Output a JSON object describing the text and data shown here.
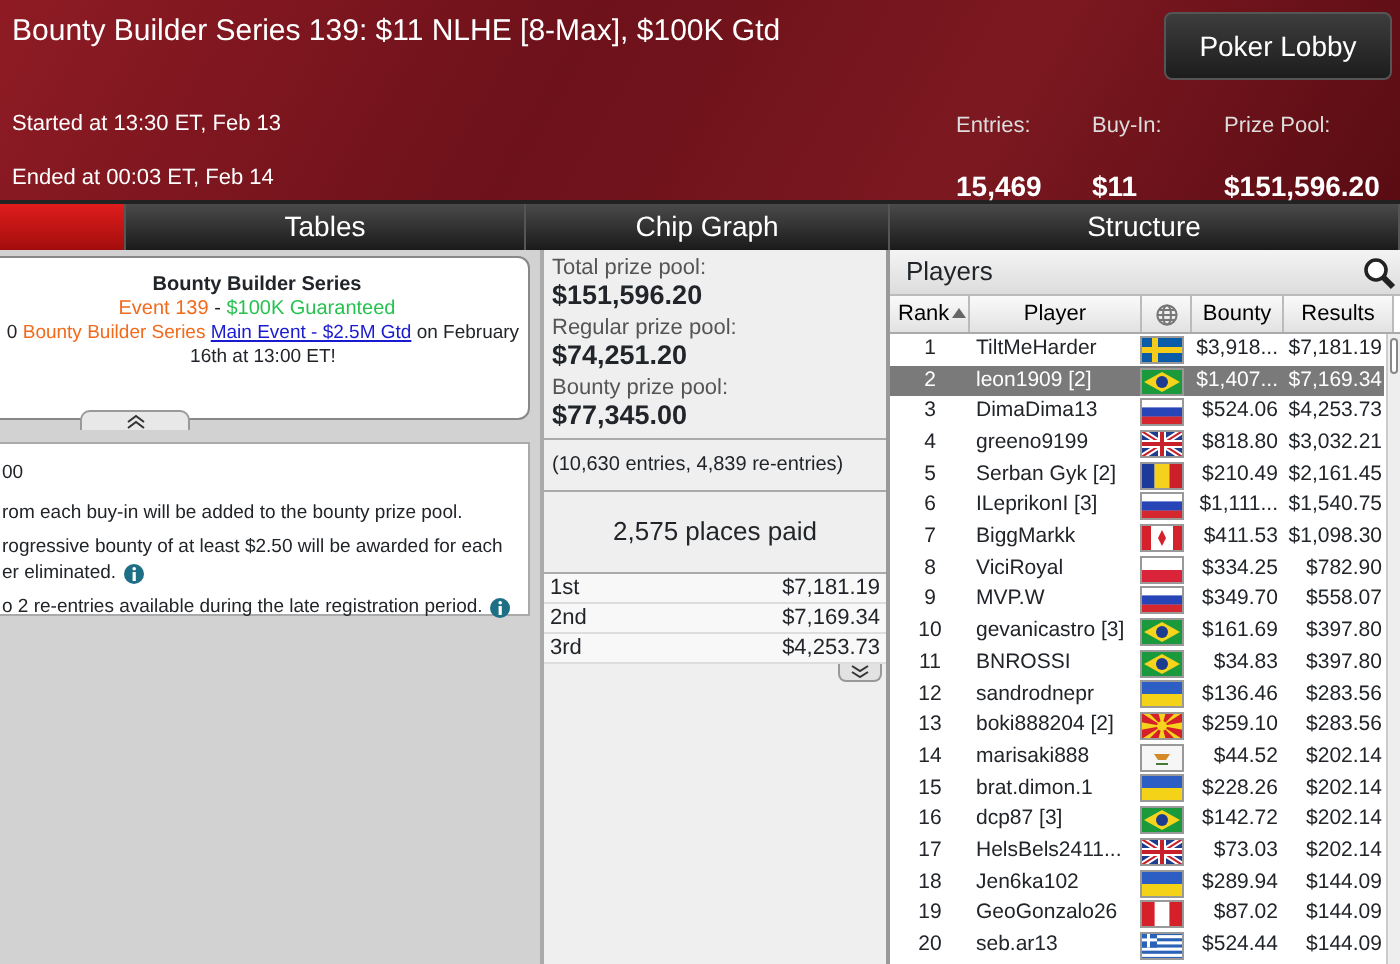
{
  "header": {
    "title": "Bounty Builder Series 139: $11 NLHE [8-Max], $100K Gtd",
    "lobby_button": "Poker Lobby",
    "started": "Started at 13:30 ET, Feb 13",
    "ended": "Ended at 00:03 ET, Feb 14",
    "stats": [
      {
        "label": "Entries:",
        "value": "15,469"
      },
      {
        "label": "Buy-In:",
        "value": "$11"
      },
      {
        "label": "Prize Pool:",
        "value": "$151,596.20"
      }
    ]
  },
  "tabs": [
    {
      "selected": true
    },
    {
      "label": "Tables",
      "selected": false
    },
    {
      "label": "Chip Graph",
      "selected": false
    },
    {
      "label": "Structure",
      "selected": false
    }
  ],
  "info": {
    "heading": "Bounty Builder Series",
    "event_line": [
      {
        "text": "Event 139",
        "kind": "orange"
      },
      {
        "text": " - ",
        "kind": "plain"
      },
      {
        "text": "$100K Guaranteed",
        "kind": "green"
      }
    ],
    "promo": [
      {
        "text": "0 ",
        "kind": "plain"
      },
      {
        "text": "Bounty Builder Series ",
        "kind": "orange"
      },
      {
        "text": "Main Event - $2.5M Gtd",
        "kind": "link"
      },
      {
        "text": " on February 16th at 13:00 ET!",
        "kind": "plain"
      }
    ]
  },
  "details": [
    {
      "text": "00",
      "info": false
    },
    {
      "text": "rom each buy-in will be added to the bounty prize pool.",
      "info": false
    },
    {
      "text": "rogressive bounty of at least $2.50 will be awarded for each",
      "info": false
    },
    {
      "text": "er eliminated.",
      "info": true
    },
    {
      "text": "o 2 re-entries available during the late registration period.",
      "info": true
    }
  ],
  "prizes": {
    "pools": [
      {
        "label": "Total prize pool:",
        "value": "$151,596.20"
      },
      {
        "label": "Regular prize pool:",
        "value": "$74,251.20"
      },
      {
        "label": "Bounty prize pool:",
        "value": "$77,345.00"
      }
    ],
    "entries_note": "(10,630 entries, 4,839 re-entries)",
    "places_paid": "2,575 places paid",
    "payouts": [
      {
        "place": "1st",
        "amount": "$7,181.19"
      },
      {
        "place": "2nd",
        "amount": "$7,169.34"
      },
      {
        "place": "3rd",
        "amount": "$4,253.73"
      }
    ]
  },
  "players": {
    "title": "Players",
    "columns": [
      "Rank",
      "Player",
      "Bounty",
      "Results"
    ],
    "rows": [
      {
        "rank": "1",
        "player": "TiltMeHarder",
        "kind": "sweden",
        "bounty": "$3,918...",
        "results": "$7,181.19",
        "selected": false
      },
      {
        "rank": "2",
        "player": "leon1909 [2]",
        "kind": "brazil",
        "bounty": "$1,407...",
        "results": "$7,169.34",
        "selected": true
      },
      {
        "rank": "3",
        "player": "DimaDima13",
        "kind": "russia",
        "bounty": "$524.06",
        "results": "$4,253.73",
        "selected": false
      },
      {
        "rank": "4",
        "player": "greeno9199",
        "kind": "britain",
        "bounty": "$818.80",
        "results": "$3,032.21",
        "selected": false
      },
      {
        "rank": "5",
        "player": "Serban Gyk [2]",
        "kind": "romania",
        "bounty": "$210.49",
        "results": "$2,161.45",
        "selected": false
      },
      {
        "rank": "6",
        "player": "ILeprikonI [3]",
        "kind": "russia",
        "bounty": "$1,111...",
        "results": "$1,540.75",
        "selected": false
      },
      {
        "rank": "7",
        "player": "BiggMarkk",
        "kind": "canada",
        "bounty": "$411.53",
        "results": "$1,098.30",
        "selected": false
      },
      {
        "rank": "8",
        "player": "ViciRoyal",
        "kind": "poland",
        "bounty": "$334.25",
        "results": "$782.90",
        "selected": false
      },
      {
        "rank": "9",
        "player": "MVP.W",
        "kind": "russia",
        "bounty": "$349.70",
        "results": "$558.07",
        "selected": false
      },
      {
        "rank": "10",
        "player": "gevanicastro [3]",
        "kind": "brazil",
        "bounty": "$161.69",
        "results": "$397.80",
        "selected": false
      },
      {
        "rank": "11",
        "player": "BNROSSI",
        "kind": "brazil",
        "bounty": "$34.83",
        "results": "$397.80",
        "selected": false
      },
      {
        "rank": "12",
        "player": "sandrodnepr",
        "kind": "ukraine",
        "bounty": "$136.46",
        "results": "$283.56",
        "selected": false
      },
      {
        "rank": "13",
        "player": "boki888204 [2]",
        "kind": "macedonia",
        "bounty": "$259.10",
        "results": "$283.56",
        "selected": false
      },
      {
        "rank": "14",
        "player": "marisaki888",
        "kind": "cyprus",
        "bounty": "$44.52",
        "results": "$202.14",
        "selected": false
      },
      {
        "rank": "15",
        "player": "brat.dimon.1",
        "kind": "ukraine",
        "bounty": "$228.26",
        "results": "$202.14",
        "selected": false
      },
      {
        "rank": "16",
        "player": "dcp87 [3]",
        "kind": "brazil",
        "bounty": "$142.72",
        "results": "$202.14",
        "selected": false
      },
      {
        "rank": "17",
        "player": "HelsBels2411...",
        "kind": "britain",
        "bounty": "$73.03",
        "results": "$202.14",
        "selected": false
      },
      {
        "rank": "18",
        "player": "Jen6ka102",
        "kind": "ukraine",
        "bounty": "$289.94",
        "results": "$144.09",
        "selected": false
      },
      {
        "rank": "19",
        "player": "GeoGonzalo26",
        "kind": "peru",
        "bounty": "$87.02",
        "results": "$144.09",
        "selected": false
      },
      {
        "rank": "20",
        "player": "seb.ar13",
        "kind": "greece",
        "bounty": "$524.44",
        "results": "$144.09",
        "selected": false
      }
    ]
  }
}
